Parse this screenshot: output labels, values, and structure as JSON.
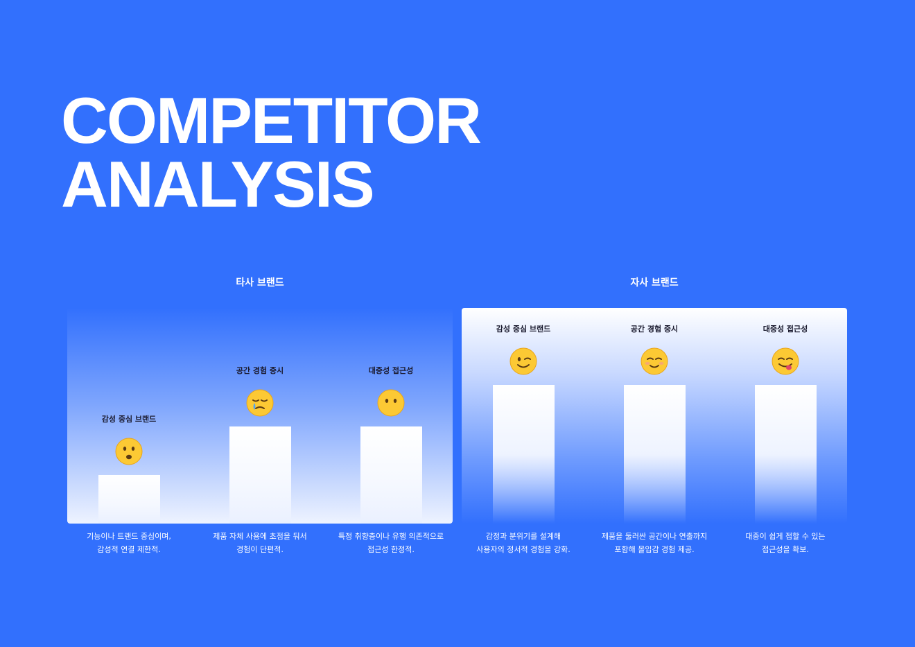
{
  "title": {
    "line1": "COMPETITOR",
    "line2": "ANALYSIS"
  },
  "chart_data": {
    "type": "bar",
    "title": "COMPETITOR ANALYSIS",
    "ylim": [
      0,
      100
    ],
    "grid": false,
    "categories": [
      "감성 중심 브랜드",
      "공간 경험 중시",
      "대중성 접근성"
    ],
    "series": [
      {
        "name": "타사 브랜드",
        "values": [
          35,
          70,
          70
        ],
        "emojis": [
          "frowning-face",
          "crying-face",
          "neutral-face"
        ],
        "descriptions": [
          [
            "기능이나 트랜드 중심이며,",
            "감성적 연결 제한적."
          ],
          [
            "제품 자체 사용에 초점을 둬서",
            "경험이 단편적."
          ],
          [
            "특정 취향층이나 유행 의존적으로",
            "접근성 한정적."
          ]
        ]
      },
      {
        "name": "자사 브랜드",
        "values": [
          100,
          100,
          100
        ],
        "emojis": [
          "winking-face",
          "smiling-blush-face",
          "yummy-face"
        ],
        "descriptions": [
          [
            "감정과 분위기를 설계해",
            "사용자의 정서적 경험을 강화."
          ],
          [
            "제품을 둘러싼 공간이나 연출까지",
            "포함해 몰입감 경험 제공."
          ],
          [
            "대중이 쉽게 접할 수 있는",
            "접근성을 확보."
          ]
        ]
      }
    ]
  },
  "colors": {
    "background": "#3270fd",
    "panel_highlight": "#ffffff",
    "emoji_yellow": "#fbc02d",
    "label_text": "#1a1a2e"
  }
}
